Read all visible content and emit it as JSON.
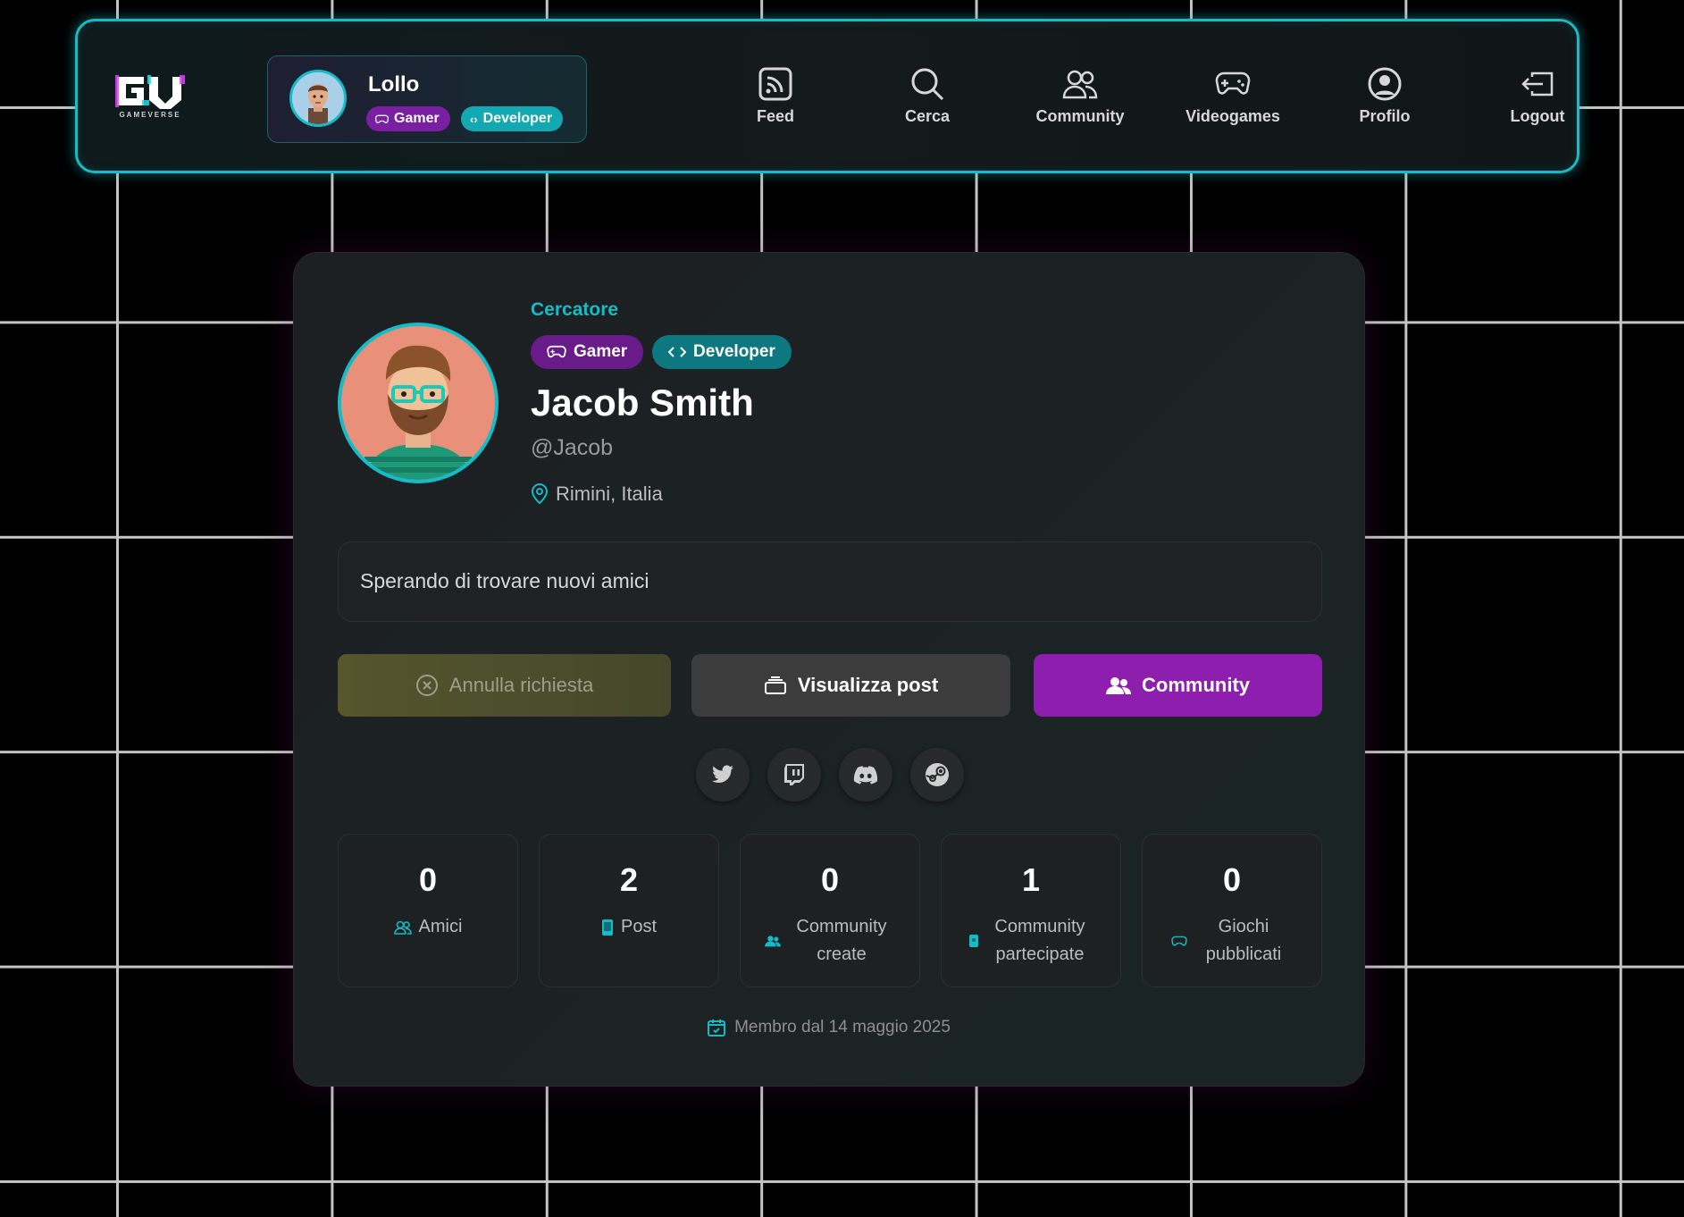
{
  "app": {
    "logo_text": "GV",
    "logo_subtitle": "GAMEVERSE"
  },
  "nav": {
    "user": {
      "name": "Lollo",
      "badges": [
        "Gamer",
        "Developer"
      ]
    },
    "items": [
      {
        "label": "Feed",
        "icon": "rss-icon"
      },
      {
        "label": "Cerca",
        "icon": "search-icon"
      },
      {
        "label": "Community",
        "icon": "users-icon"
      },
      {
        "label": "Videogames",
        "icon": "gamepad-icon"
      },
      {
        "label": "Profilo",
        "icon": "user-circle-icon"
      },
      {
        "label": "Logout",
        "icon": "logout-icon"
      }
    ]
  },
  "profile": {
    "role": "Cercatore",
    "badges": [
      "Gamer",
      "Developer"
    ],
    "name": "Jacob Smith",
    "handle": "@Jacob",
    "location": "Rimini, Italia",
    "bio": "Sperando di trovare nuovi amici",
    "actions": {
      "cancel": "Annulla richiesta",
      "posts": "Visualizza post",
      "community": "Community"
    },
    "socials": [
      "twitter-icon",
      "twitch-icon",
      "discord-icon",
      "steam-icon"
    ],
    "stats": [
      {
        "value": "0",
        "label": "Amici"
      },
      {
        "value": "2",
        "label": "Post"
      },
      {
        "value": "0",
        "label": "Community create"
      },
      {
        "value": "1",
        "label": "Community partecipate"
      },
      {
        "value": "0",
        "label": "Giochi pubblicati"
      }
    ],
    "member_since": "Membro dal 14 maggio 2025"
  },
  "colors": {
    "accent": "#13bcc7",
    "gamer": "#7b1fa2",
    "community_button": "#8e1fae",
    "background": "#000000"
  }
}
